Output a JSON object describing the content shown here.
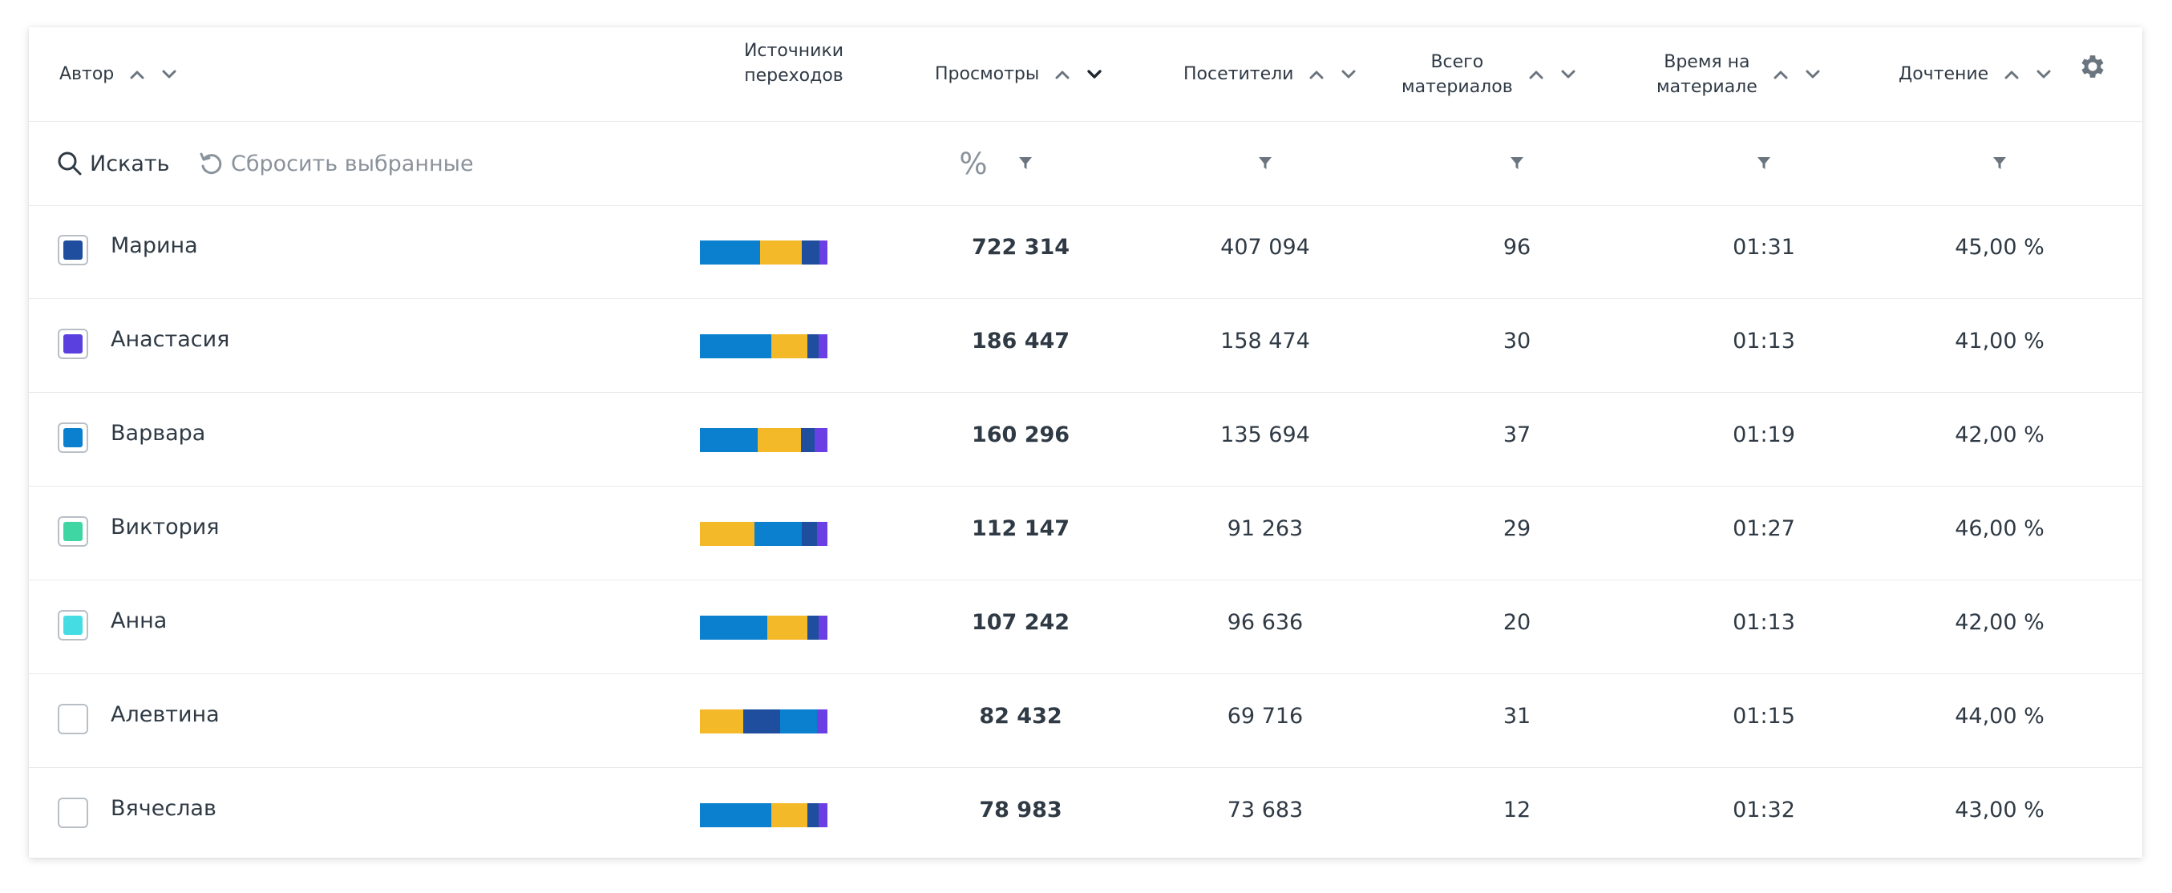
{
  "header": {
    "author": "Автор",
    "sources_line1": "Источники",
    "sources_line2": "переходов",
    "views": "Просмотры",
    "visitors": "Посетители",
    "materials_line1": "Всего",
    "materials_line2": "материалов",
    "time_line1": "Время на",
    "time_line2": "материале",
    "readthrough": "Дочтение"
  },
  "filters": {
    "search_label": "Искать",
    "reset_label": "Сбросить выбранные",
    "percent_label": "%"
  },
  "colors": {
    "source_blue": "#0a80cf",
    "source_yellow": "#f4b928",
    "source_navy": "#1f4e9e",
    "source_purple": "#6a3fe4"
  },
  "rows": [
    {
      "name": "Марина",
      "swatch": "#1f4e9e",
      "views": "722 314",
      "visitors": "407 094",
      "materials": "96",
      "time": "01:31",
      "readthrough": "45,00 %",
      "sources": [
        {
          "color": "#0a80cf",
          "share": 0.47
        },
        {
          "color": "#f4b928",
          "share": 0.33
        },
        {
          "color": "#1f4e9e",
          "share": 0.14
        },
        {
          "color": "#6a3fe4",
          "share": 0.06
        }
      ]
    },
    {
      "name": "Анастасия",
      "swatch": "#5b40e0",
      "views": "186 447",
      "visitors": "158 474",
      "materials": "30",
      "time": "01:13",
      "readthrough": "41,00 %",
      "sources": [
        {
          "color": "#0a80cf",
          "share": 0.56
        },
        {
          "color": "#f4b928",
          "share": 0.28
        },
        {
          "color": "#1f4e9e",
          "share": 0.09
        },
        {
          "color": "#6a3fe4",
          "share": 0.07
        }
      ]
    },
    {
      "name": "Варвара",
      "swatch": "#0a80cf",
      "views": "160 296",
      "visitors": "135 694",
      "materials": "37",
      "time": "01:19",
      "readthrough": "42,00 %",
      "sources": [
        {
          "color": "#0a80cf",
          "share": 0.45
        },
        {
          "color": "#f4b928",
          "share": 0.34
        },
        {
          "color": "#1f4e9e",
          "share": 0.11
        },
        {
          "color": "#6a3fe4",
          "share": 0.1
        }
      ]
    },
    {
      "name": "Виктория",
      "swatch": "#3fd6a3",
      "views": "112 147",
      "visitors": "91 263",
      "materials": "29",
      "time": "01:27",
      "readthrough": "46,00 %",
      "sources": [
        {
          "color": "#f4b928",
          "share": 0.43
        },
        {
          "color": "#0a80cf",
          "share": 0.37
        },
        {
          "color": "#1f4e9e",
          "share": 0.12
        },
        {
          "color": "#6a3fe4",
          "share": 0.08
        }
      ]
    },
    {
      "name": "Анна",
      "swatch": "#45dde3",
      "views": "107 242",
      "visitors": "96 636",
      "materials": "20",
      "time": "01:13",
      "readthrough": "42,00 %",
      "sources": [
        {
          "color": "#0a80cf",
          "share": 0.53
        },
        {
          "color": "#f4b928",
          "share": 0.31
        },
        {
          "color": "#1f4e9e",
          "share": 0.09
        },
        {
          "color": "#6a3fe4",
          "share": 0.07
        }
      ]
    },
    {
      "name": "Алевтина",
      "swatch": "",
      "views": "82 432",
      "visitors": "69 716",
      "materials": "31",
      "time": "01:15",
      "readthrough": "44,00 %",
      "sources": [
        {
          "color": "#f4b928",
          "share": 0.34
        },
        {
          "color": "#1f4e9e",
          "share": 0.29
        },
        {
          "color": "#0a80cf",
          "share": 0.29
        },
        {
          "color": "#6a3fe4",
          "share": 0.08
        }
      ]
    },
    {
      "name": "Вячеслав",
      "swatch": "",
      "views": "78 983",
      "visitors": "73 683",
      "materials": "12",
      "time": "01:32",
      "readthrough": "43,00 %",
      "sources": [
        {
          "color": "#0a80cf",
          "share": 0.56
        },
        {
          "color": "#f4b928",
          "share": 0.28
        },
        {
          "color": "#1f4e9e",
          "share": 0.09
        },
        {
          "color": "#6a3fe4",
          "share": 0.07
        }
      ]
    }
  ]
}
